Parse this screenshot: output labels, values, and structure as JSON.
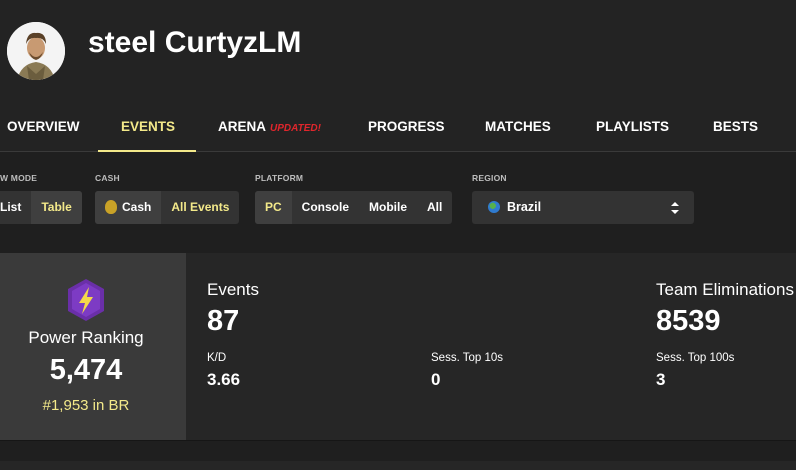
{
  "header": {
    "player_name": "steel CurtyzLM",
    "avatar_icon": "character-avatar-icon"
  },
  "nav": {
    "tabs": [
      {
        "label": "OVERVIEW"
      },
      {
        "label": "EVENTS",
        "active": true
      },
      {
        "label": "ARENA",
        "badge": "UPDATED!"
      },
      {
        "label": "PROGRESS"
      },
      {
        "label": "MATCHES"
      },
      {
        "label": "PLAYLISTS"
      },
      {
        "label": "BESTS"
      }
    ]
  },
  "filters": {
    "view_mode": {
      "label": "W MODE",
      "options": [
        "List",
        "Table"
      ],
      "selected": "Table"
    },
    "cash": {
      "label": "CASH",
      "options": [
        "Cash",
        "All Events"
      ],
      "selected": "All Events"
    },
    "platform": {
      "label": "PLATFORM",
      "options": [
        "PC",
        "Console",
        "Mobile",
        "All"
      ],
      "selected": "PC"
    },
    "region": {
      "label": "REGION",
      "value": "Brazil"
    }
  },
  "stats": {
    "power_ranking": {
      "label": "Power Ranking",
      "value": "5,474",
      "rank": "#1,953 in BR"
    },
    "events": {
      "label": "Events",
      "value": "87"
    },
    "team_eliminations": {
      "label": "Team Eliminations",
      "value": "8539"
    },
    "kd": {
      "label": "K/D",
      "value": "3.66"
    },
    "sess_top10": {
      "label": "Sess. Top 10s",
      "value": "0"
    },
    "sess_top100": {
      "label": "Sess. Top 100s",
      "value": "3"
    }
  },
  "colors": {
    "accent": "#f3e98a",
    "updated": "#e0262c",
    "power_icon": "#6a2fa8"
  }
}
